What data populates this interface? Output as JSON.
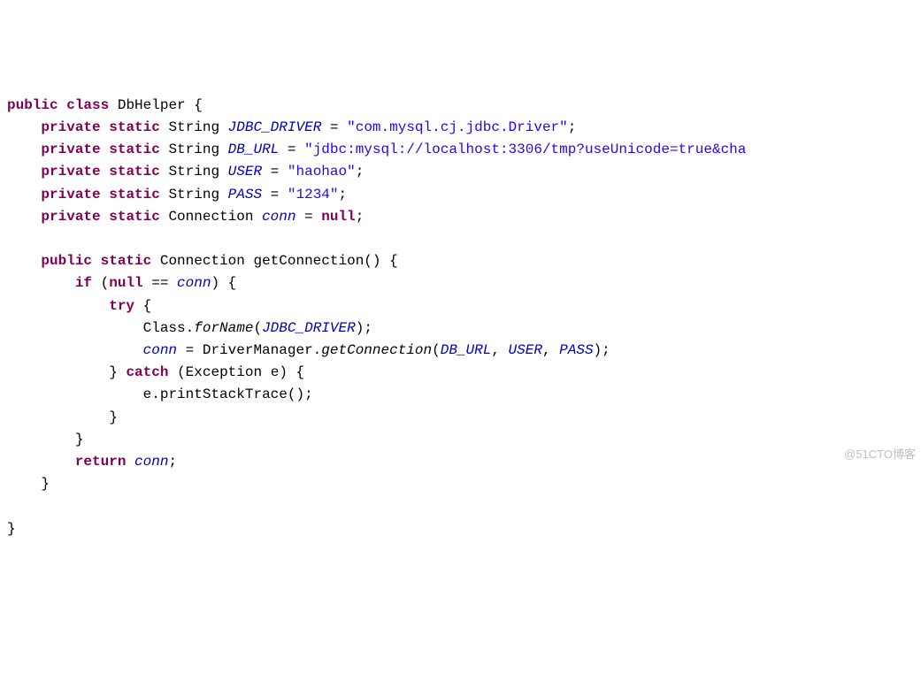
{
  "code": {
    "kw_public": "public",
    "kw_class": "class",
    "kw_private": "private",
    "kw_static": "static",
    "kw_if": "if",
    "kw_try": "try",
    "kw_catch": "catch",
    "kw_return": "return",
    "kw_null": "null",
    "class_name": "DbHelper",
    "type_String": "String",
    "type_Connection": "Connection",
    "type_Exception": "Exception",
    "type_Class": "Class",
    "type_DriverManager": "DriverManager",
    "field_JDBC_DRIVER": "JDBC_DRIVER",
    "field_DB_URL": "DB_URL",
    "field_USER": "USER",
    "field_PASS": "PASS",
    "field_conn": "conn",
    "str_driver": "\"com.mysql.cj.jdbc.Driver\"",
    "str_url": "\"jdbc:mysql://localhost:3306/tmp?useUnicode=true&cha",
    "str_user": "\"haohao\"",
    "str_pass": "\"1234\"",
    "method_getConnection": "getConnection",
    "method_forName": "forName",
    "method_printStackTrace": "printStackTrace",
    "var_e": "e",
    "eq": " = ",
    "semi": ";",
    "lbrace": "{",
    "rbrace": "}",
    "lparen": "(",
    "rparen": ")",
    "dot": ".",
    "comma": ", ",
    "dbleq": " == "
  },
  "watermark": "@51CTO博客"
}
